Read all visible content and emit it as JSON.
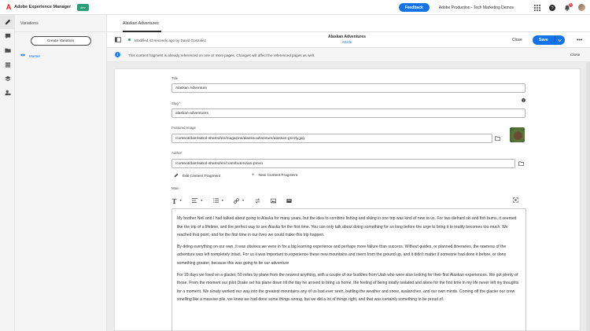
{
  "topbar": {
    "app_title": "Adobe Experience Manager",
    "env_badge": "dev",
    "feedback_label": "Feedback",
    "org_name": "Adobe Production - Tech Marketing Demos",
    "notification_count": "1"
  },
  "rail": {
    "icons": [
      "pencil-icon",
      "comment-icon",
      "folder-icon",
      "stack-icon",
      "layers-icon",
      "user-settings-icon"
    ]
  },
  "variations": {
    "title": "Variations",
    "create_label": "Create Variation",
    "master_label": "Master"
  },
  "tabstrip": {
    "tab_label": "Alaskan Adventures"
  },
  "editor": {
    "modified_text": "Modified 43 seconds ago by David Gonzalez",
    "doc_title": "Alaskan Adventures",
    "doc_model": "Article",
    "close_label": "Close",
    "save_label": "Save"
  },
  "infobar": {
    "message": "This content fragment is already referenced on one or more pages. Changes will affect the referenced pages as well.",
    "close_label": "Close"
  },
  "form": {
    "title_label": "Title",
    "title_value": "Alaskan Adventure",
    "slug_label": "Slug *",
    "slug_value": "alaskan-adventures",
    "image_label": "Featured Image",
    "image_value": "/content/dam/wknd-shared/en/magazine/alaska-adventure/alaskan-grizzly.jpg",
    "author_label": "Author",
    "author_value": "/content/dam/wknd-shared/en/contributors/ian-provo",
    "edit_fragment_label": "Edit Content Fragment",
    "new_fragment_label": "New Content Fragment",
    "main_label": "Main"
  },
  "main_text": {
    "p1": "My brother Neil and I had talked about going to Alaska for many years, but the idea to combine fishing and skiing in one trip was kind of new to us. For two diehard ski and fish bums, it seemed like the trip of a lifetime, and the perfect way to see Alaska for the first time. You can only talk about doing something for so long before the urge to bring it to reality becomes too much. We reached that point, and for the first time in our lives we could make this trip happen.",
    "p2": "By doing everything on our own, it was obvious we were in for a big learning experience and perhaps more failure than success. Without guides, or planned itineraries, the rawness of the adventure was left completely intact. For us it was important to experience these new mountains and rivers from the ground up, and it didn't matter if someone had done it before, or done something greater, because this was going to be our adventure",
    "p3": "For 18 days we lived on a glacier, 50 miles by plane from the nearest anything, with a couple of our buddies from Utah who were also looking for their first Alaskan experiences. We got plenty of those. From the moment our pilot Drake set his plane down till the day he arrived to bring us home, the feeling of being totally isolated and alone for the first time in my life never left my thoughts for a moment. We slowly worked our way into the greatest mountains any of us had ever seen, battling the weather and snow, avalanches, and our own minds. Coming off the glacier our crew smelling like a massive pile, we knew we had done some things wrong, but we did a lot of things right, and that was certainly something to be proud of."
  }
}
